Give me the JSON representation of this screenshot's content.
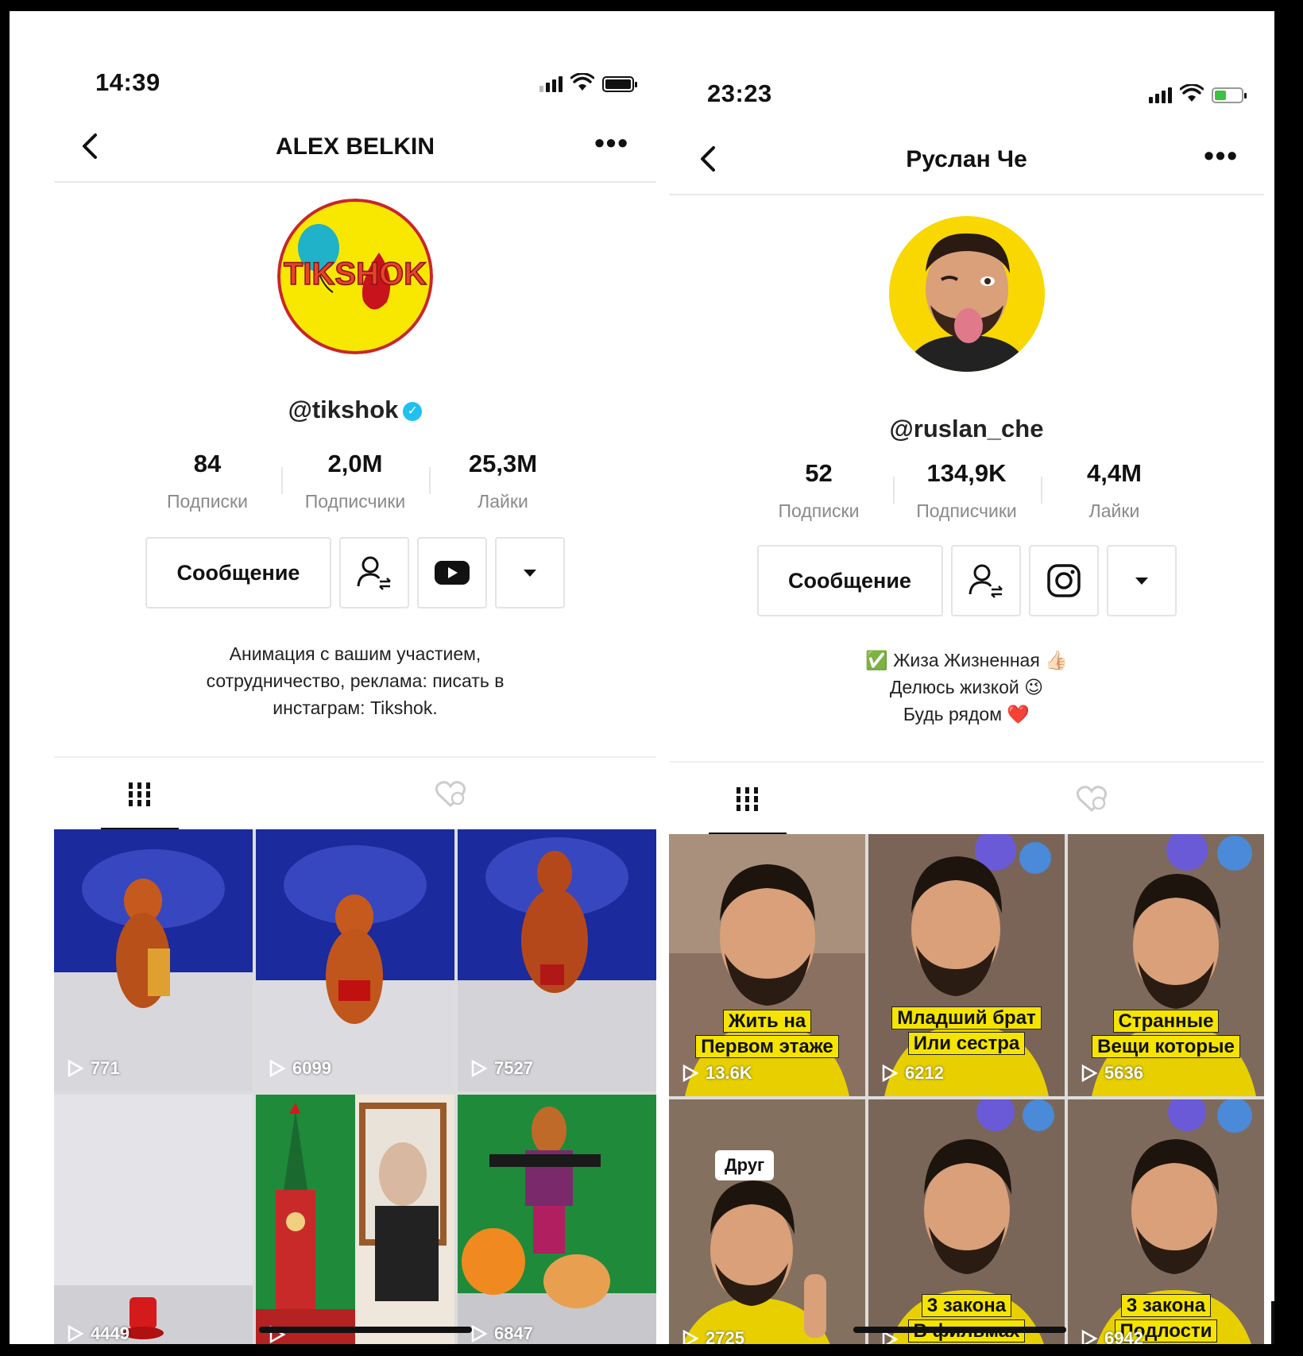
{
  "left": {
    "status_time": "14:39",
    "nav_title": "ALEX BELKIN",
    "more_label": "•••",
    "avatar_text": "TIKSHOK",
    "username": "@tikshok",
    "stats": [
      {
        "num": "84",
        "label": "Подписки"
      },
      {
        "num": "2,0M",
        "label": "Подписчики"
      },
      {
        "num": "25,3M",
        "label": "Лайки"
      }
    ],
    "message_button": "Сообщение",
    "bio_lines": [
      "Анимация с вашим участием,",
      "сотрудничество, реклама: писать в",
      "инстаграм: Tikshok."
    ],
    "videos": [
      {
        "views": "771"
      },
      {
        "views": "6099"
      },
      {
        "views": "7527"
      },
      {
        "views": "4449"
      },
      {
        "views": ""
      },
      {
        "views": "6847"
      }
    ]
  },
  "right": {
    "status_time": "23:23",
    "nav_title": "Руслан Че",
    "more_label": "•••",
    "username": "@ruslan_che",
    "stats": [
      {
        "num": "52",
        "label": "Подписки"
      },
      {
        "num": "134,9K",
        "label": "Подписчики"
      },
      {
        "num": "4,4M",
        "label": "Лайки"
      }
    ],
    "message_button": "Сообщение",
    "bio_lines": [
      "✅ Жиза Жизненная 👍🏻",
      "Делюсь жизкой 😉",
      "Будь рядом ❤️"
    ],
    "videos": [
      {
        "views": "13.6K",
        "caption": [
          "Жить на",
          "Первом этаже"
        ]
      },
      {
        "views": "6212",
        "caption": [
          "Младший брат",
          "Или сестра"
        ]
      },
      {
        "views": "5636",
        "caption": [
          "Странные",
          "Вещи которые"
        ]
      },
      {
        "views": "2725",
        "tag": "Друг"
      },
      {
        "views": "",
        "caption": [
          "3 закона",
          "В фильмах"
        ]
      },
      {
        "views": "6942",
        "caption": [
          "3 закона",
          "Подлости"
        ]
      }
    ]
  },
  "colors": {
    "verified": "#20c0f0",
    "caption_bg": "#f5e400",
    "stage_blue": "#1b2a9c",
    "avatar_yellow": "#f8d800"
  },
  "icons": [
    "back-chevron-icon",
    "more-dots-icon",
    "add-friend-icon",
    "youtube-icon",
    "instagram-icon",
    "dropdown-arrow-icon",
    "videos-grid-icon",
    "liked-heart-icon",
    "play-icon"
  ]
}
